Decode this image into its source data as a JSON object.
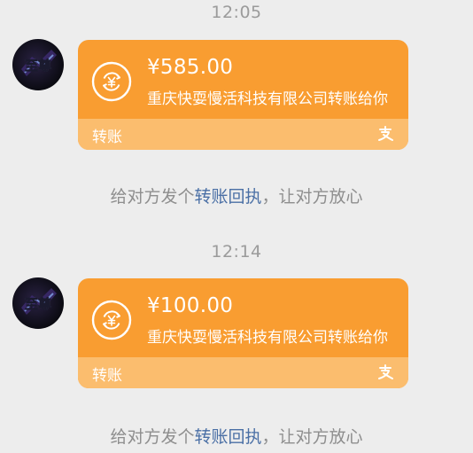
{
  "messages": [
    {
      "timestamp": "12:05",
      "transfer": {
        "amount": "¥585.00",
        "description": "重庆快耍慢活科技有限公司转账给你",
        "footer_label": "转账",
        "icon": "transfer-return-icon",
        "footer_icon": "alipay-icon"
      },
      "receipt": {
        "prefix": "给对方发个",
        "link": "转账回执",
        "suffix": "，让对方放心"
      }
    },
    {
      "timestamp": "12:14",
      "transfer": {
        "amount": "¥100.00",
        "description": "重庆快耍慢活科技有限公司转账给你",
        "footer_label": "转账",
        "icon": "transfer-return-icon",
        "footer_icon": "alipay-icon"
      },
      "receipt": {
        "prefix": "给对方发个",
        "link": "转账回执",
        "suffix": "，让对方放心"
      }
    }
  ],
  "colors": {
    "background": "#ededed",
    "card": "#f99d31",
    "card_footer": "#fbbd6e",
    "link": "#4a6fa5",
    "muted_text": "#9b9b9b"
  }
}
